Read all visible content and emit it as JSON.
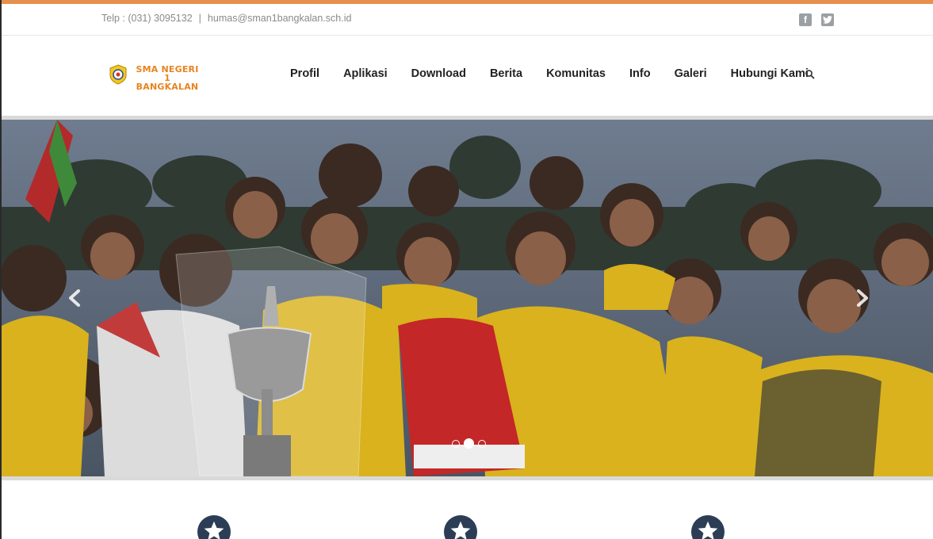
{
  "topbar": {
    "phone": "Telp : (031) 3095132",
    "separator": "|",
    "email": "humas@sman1bangkalan.sch.id",
    "social": [
      {
        "icon": "facebook-icon",
        "glyph": "f"
      },
      {
        "icon": "twitter-icon",
        "glyph": "t"
      }
    ]
  },
  "logo": {
    "line1": "SMA NEGERI 1",
    "line2": "BANGKALAN",
    "color": "#e8841e"
  },
  "nav": {
    "items": [
      "Profil",
      "Aplikasi",
      "Download",
      "Berita",
      "Komunitas",
      "Info",
      "Galeri",
      "Hubungi Kami"
    ],
    "search_icon": "search-icon"
  },
  "slider": {
    "prev_icon": "chevron-left-icon",
    "next_icon": "chevron-right-icon",
    "slide_count": 3,
    "active_slide": 2
  },
  "features": {
    "icon": "star-icon",
    "count": 3
  },
  "colors": {
    "accent": "#e6904f",
    "feature_icon_bg": "#2c3e56"
  }
}
